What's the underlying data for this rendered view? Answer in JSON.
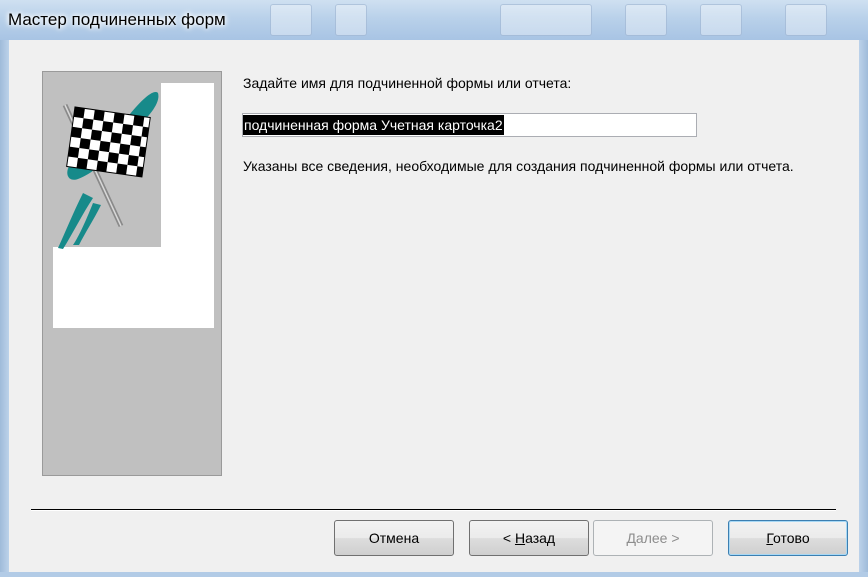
{
  "window": {
    "title": "Мастер подчиненных форм"
  },
  "wizard": {
    "prompt": "Задайте имя для подчиненной формы или отчета:",
    "name_value": "подчиненная форма Учетная карточка2",
    "info_text": "Указаны все сведения, необходимые для создания подчиненной формы или отчета."
  },
  "buttons": {
    "cancel": "Отмена",
    "back_prefix": "< ",
    "back_mnemonic": "Н",
    "back_rest": "азад",
    "next": "Далее >",
    "finish_mnemonic": "Г",
    "finish_rest": "отово"
  },
  "colors": {
    "dialog_bg": "#f0f0f0",
    "panel_gray": "#c0c0c0",
    "flag_teal": "#178a8a",
    "selection": "#000000"
  },
  "icons": {
    "wizard_graphic": "checkered-flag-icon"
  }
}
